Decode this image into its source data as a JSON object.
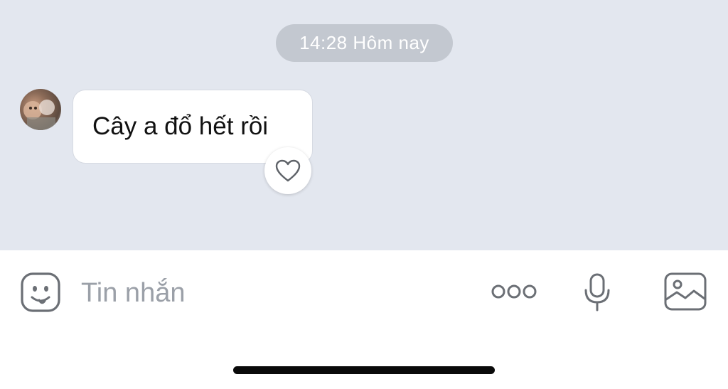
{
  "header": {
    "timestamp": "14:28 Hôm nay"
  },
  "messages": [
    {
      "sender_avatar": "avatar-photo",
      "text": "Cây a đổ hết rồi",
      "reaction_icon": "heart-outline-icon"
    }
  ],
  "composer": {
    "placeholder": "Tin nhắn",
    "icons": [
      "sticker-icon",
      "more-dots-icon",
      "microphone-icon",
      "image-gallery-icon"
    ]
  },
  "colors": {
    "chat_background": "#e3e7ef",
    "timestamp_pill": "#c3c8d0",
    "icon_gray": "#6b6f75",
    "placeholder_gray": "#9ba0a8"
  }
}
